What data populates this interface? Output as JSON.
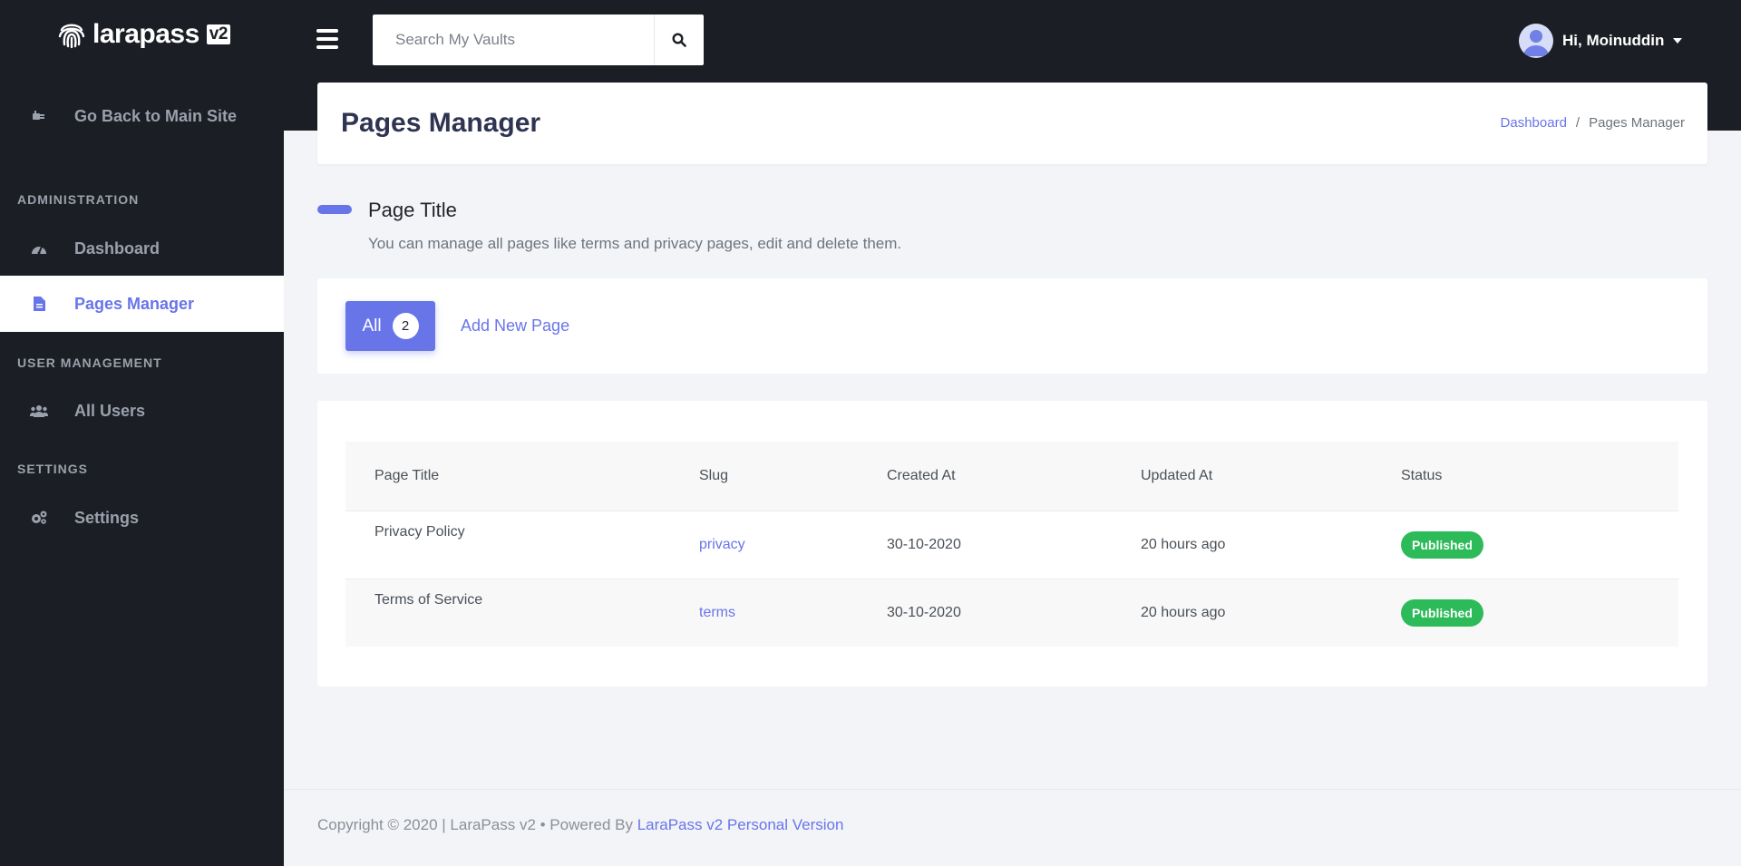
{
  "brand": {
    "name": "larapass",
    "version": "v2"
  },
  "sidebar": {
    "back_link": "Go Back to Main Site",
    "sections": [
      {
        "title": "ADMINISTRATION",
        "items": [
          {
            "label": "Dashboard",
            "icon": "tachometer-icon",
            "active": false
          },
          {
            "label": "Pages Manager",
            "icon": "file-icon",
            "active": true
          }
        ]
      },
      {
        "title": "USER MANAGEMENT",
        "items": [
          {
            "label": "All Users",
            "icon": "users-icon",
            "active": false
          }
        ]
      },
      {
        "title": "SETTINGS",
        "items": [
          {
            "label": "Settings",
            "icon": "gears-icon",
            "active": false
          }
        ]
      }
    ]
  },
  "header": {
    "search_placeholder": "Search My Vaults",
    "user_greeting": "Hi, Moinuddin"
  },
  "page": {
    "title": "Pages Manager",
    "breadcrumb": [
      "Dashboard",
      "Pages Manager"
    ],
    "breadcrumb_sep": "/",
    "section_title": "Page Title",
    "section_desc": "You can manage all pages like terms and privacy pages, edit and delete them."
  },
  "tabs": {
    "all_label": "All",
    "all_count": "2",
    "add_label": "Add New Page"
  },
  "table": {
    "columns": [
      "Page Title",
      "Slug",
      "Created At",
      "Updated At",
      "Status"
    ],
    "rows": [
      {
        "title": "Privacy Policy",
        "slug": "privacy",
        "created": "30-10-2020",
        "updated": "20 hours ago",
        "status": "Published"
      },
      {
        "title": "Terms of Service",
        "slug": "terms",
        "created": "30-10-2020",
        "updated": "20 hours ago",
        "status": "Published"
      }
    ]
  },
  "footer": {
    "text": "Copyright © 2020 | LaraPass v2 • Powered By ",
    "link": "LaraPass v2 Personal Version"
  },
  "colors": {
    "accent": "#6875e9",
    "sidebar_bg": "#1b1e24",
    "success": "#2dbb5a",
    "page_bg": "#f3f4f8"
  }
}
